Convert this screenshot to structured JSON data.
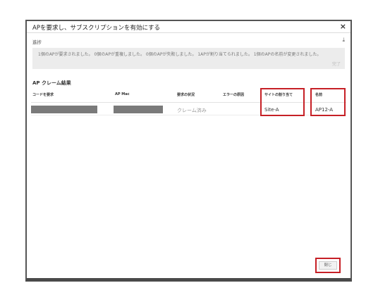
{
  "dialog": {
    "title": "APを要求し、サブスクリプションを有効にする",
    "close_glyph": "×",
    "progress_label": "進捗",
    "download_glyph": "⤓",
    "progress_message": "1個のAPが要求されました。 0個のAPが重複しました。 0個のAPが失敗しました。 1APが割り当てられました。 1個のAPの名前が変更されました。",
    "progress_status": "完了",
    "results_title": "AP クレーム結果",
    "columns": [
      "コードを要求",
      "AP Mac",
      "要求の状況",
      "エラーの原因",
      "サイトの割り当て",
      "名前"
    ],
    "rows": [
      {
        "request_code": "",
        "ap_mac": "",
        "status": "クレーム済み",
        "error": "",
        "site": "Site-A",
        "name": "AP12-A"
      }
    ],
    "close_button_label": "閉じ"
  },
  "colors": {
    "highlight": "#c62026",
    "redaction": "#7a7a7a",
    "progress_bg": "#ececec"
  }
}
